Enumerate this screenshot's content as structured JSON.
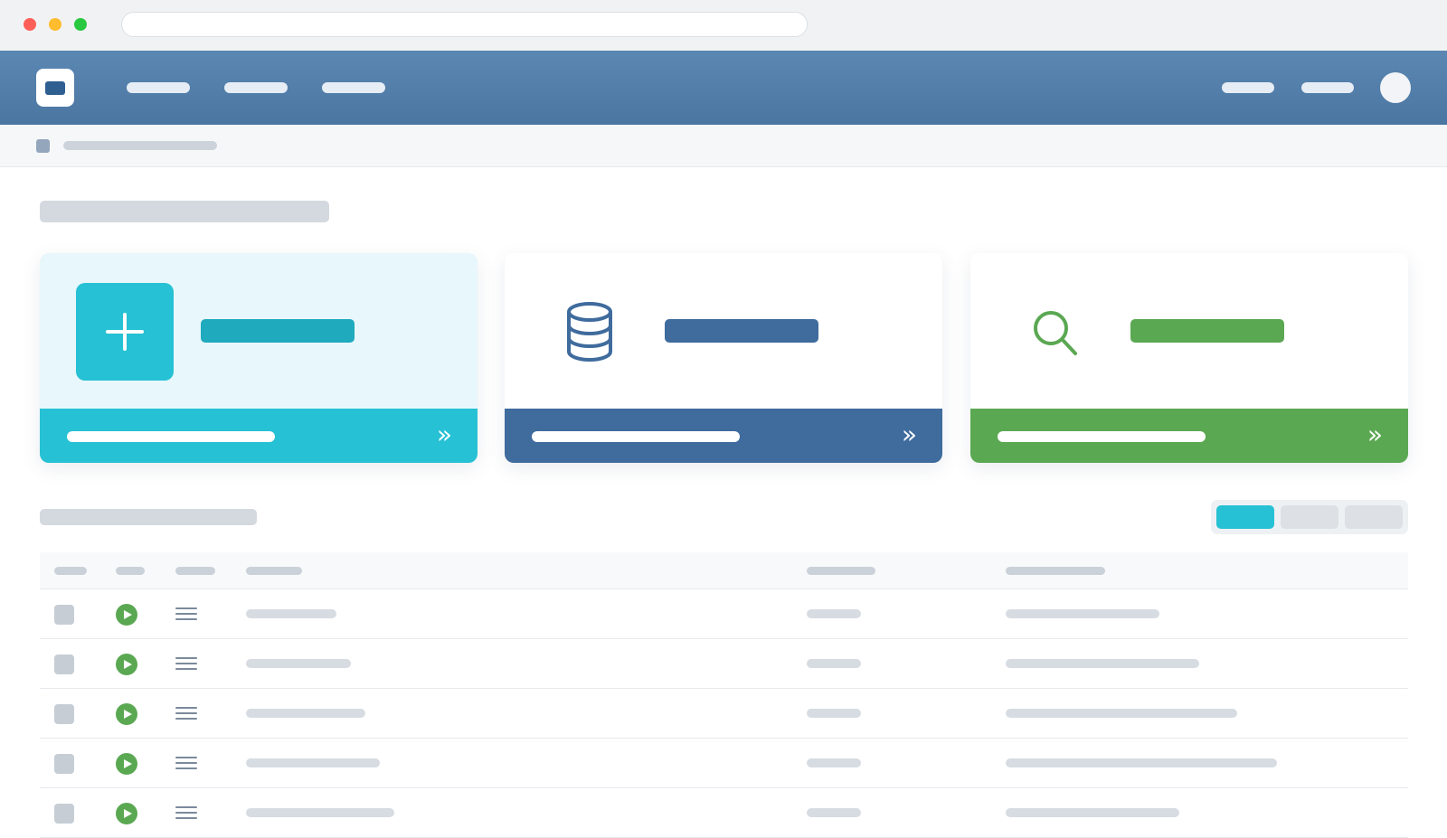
{
  "browser": {
    "traffic_lights": [
      "#ff5f57",
      "#febc2e",
      "#28c840"
    ],
    "address": ""
  },
  "nav": {
    "brand_color": "#4f7aa5",
    "logo_icon": "app-logo-icon",
    "links": [
      "",
      "",
      ""
    ],
    "actions": [
      "",
      ""
    ],
    "avatar_icon": "user-avatar-icon"
  },
  "breadcrumb": {
    "icon": "folder-icon",
    "text": ""
  },
  "page_title": "",
  "cards": [
    {
      "icon": "plus-icon",
      "title": "",
      "footer": "",
      "chevron": "»",
      "color": "#26c1d4",
      "tint": "#e8f7fb"
    },
    {
      "icon": "database-icon",
      "title": "",
      "footer": "",
      "chevron": "»",
      "color": "#3f6b9d",
      "tint": "#ffffff"
    },
    {
      "icon": "search-icon",
      "title": "",
      "footer": "",
      "chevron": "»",
      "color": "#5ba853",
      "tint": "#ffffff"
    }
  ],
  "section_title": "",
  "filter_tabs": [
    {
      "label": "",
      "active": true
    },
    {
      "label": "",
      "active": false
    },
    {
      "label": "",
      "active": false
    }
  ],
  "table": {
    "headers": [
      "",
      "",
      "",
      "",
      "",
      ""
    ],
    "rows": [
      {
        "name": "",
        "status": "",
        "detail": ""
      },
      {
        "name": "",
        "status": "",
        "detail": ""
      },
      {
        "name": "",
        "status": "",
        "detail": ""
      },
      {
        "name": "",
        "status": "",
        "detail": ""
      },
      {
        "name": "",
        "status": "",
        "detail": ""
      }
    ],
    "row_icons": [
      "checkbox-icon",
      "play-icon",
      "menu-icon"
    ]
  }
}
